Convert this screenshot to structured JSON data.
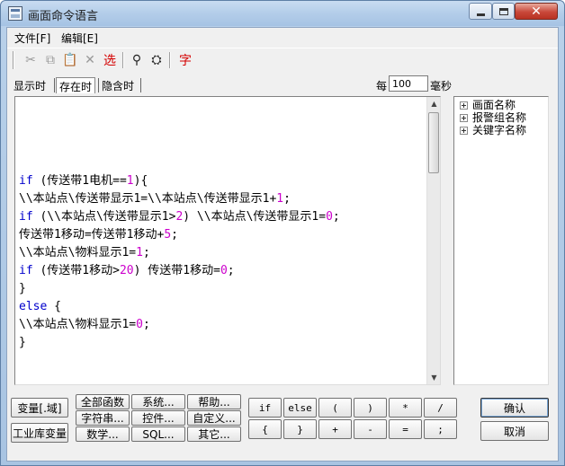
{
  "window": {
    "title": "画面命令语言"
  },
  "menu": {
    "file": "文件[F]",
    "edit": "编辑[E]"
  },
  "toolbar": {
    "select": "选",
    "font": "字"
  },
  "tabs": [
    "显示时",
    "存在时",
    "隐含时"
  ],
  "interval": {
    "label": "每",
    "value": "100",
    "unit": "毫秒"
  },
  "code": {
    "lines": [
      [
        {
          "t": "if",
          "c": "kw"
        },
        {
          "t": " (传送带1电机=="
        },
        {
          "t": "1",
          "c": "num"
        },
        {
          "t": "){"
        }
      ],
      [
        {
          "t": "\\\\本站点\\传送带显示1=\\\\本站点\\传送带显示1+"
        },
        {
          "t": "1",
          "c": "num"
        },
        {
          "t": ";"
        }
      ],
      [
        {
          "t": "if",
          "c": "kw"
        },
        {
          "t": " (\\\\本站点\\传送带显示1>"
        },
        {
          "t": "2",
          "c": "num"
        },
        {
          "t": ") \\\\本站点\\传送带显示1="
        },
        {
          "t": "0",
          "c": "num"
        },
        {
          "t": ";"
        }
      ],
      [
        {
          "t": "传送带1移动=传送带1移动+"
        },
        {
          "t": "5",
          "c": "num"
        },
        {
          "t": ";"
        }
      ],
      [
        {
          "t": "\\\\本站点\\物料显示1="
        },
        {
          "t": "1",
          "c": "num"
        },
        {
          "t": ";"
        }
      ],
      [
        {
          "t": "if",
          "c": "kw"
        },
        {
          "t": " (传送带1移动>"
        },
        {
          "t": "20",
          "c": "num"
        },
        {
          "t": ") 传送带1移动="
        },
        {
          "t": "0",
          "c": "num"
        },
        {
          "t": ";"
        }
      ],
      [
        {
          "t": "}"
        }
      ],
      [
        {
          "t": "else",
          "c": "kw"
        },
        {
          "t": " {"
        }
      ],
      [
        {
          "t": "\\\\本站点\\物料显示1="
        },
        {
          "t": "0",
          "c": "num"
        },
        {
          "t": ";"
        }
      ],
      [
        {
          "t": "}"
        }
      ]
    ]
  },
  "tree": {
    "items": [
      "画面名称",
      "报警组名称",
      "关键字名称"
    ]
  },
  "buttons": {
    "variable": "变量[.域]",
    "industrial_var": "工业库变量",
    "all_functions": "全部函数",
    "string": "字符串...",
    "math": "数学...",
    "system": "系统...",
    "control": "控件...",
    "sql": "SQL...",
    "help": "帮助...",
    "custom": "自定义...",
    "other": "其它...",
    "ops_row1": [
      "if",
      "else",
      "(",
      ")",
      "*",
      "/"
    ],
    "ops_row2": [
      "{",
      "}",
      "+",
      "-",
      "=",
      ";"
    ],
    "ok": "确认",
    "cancel": "取消"
  }
}
